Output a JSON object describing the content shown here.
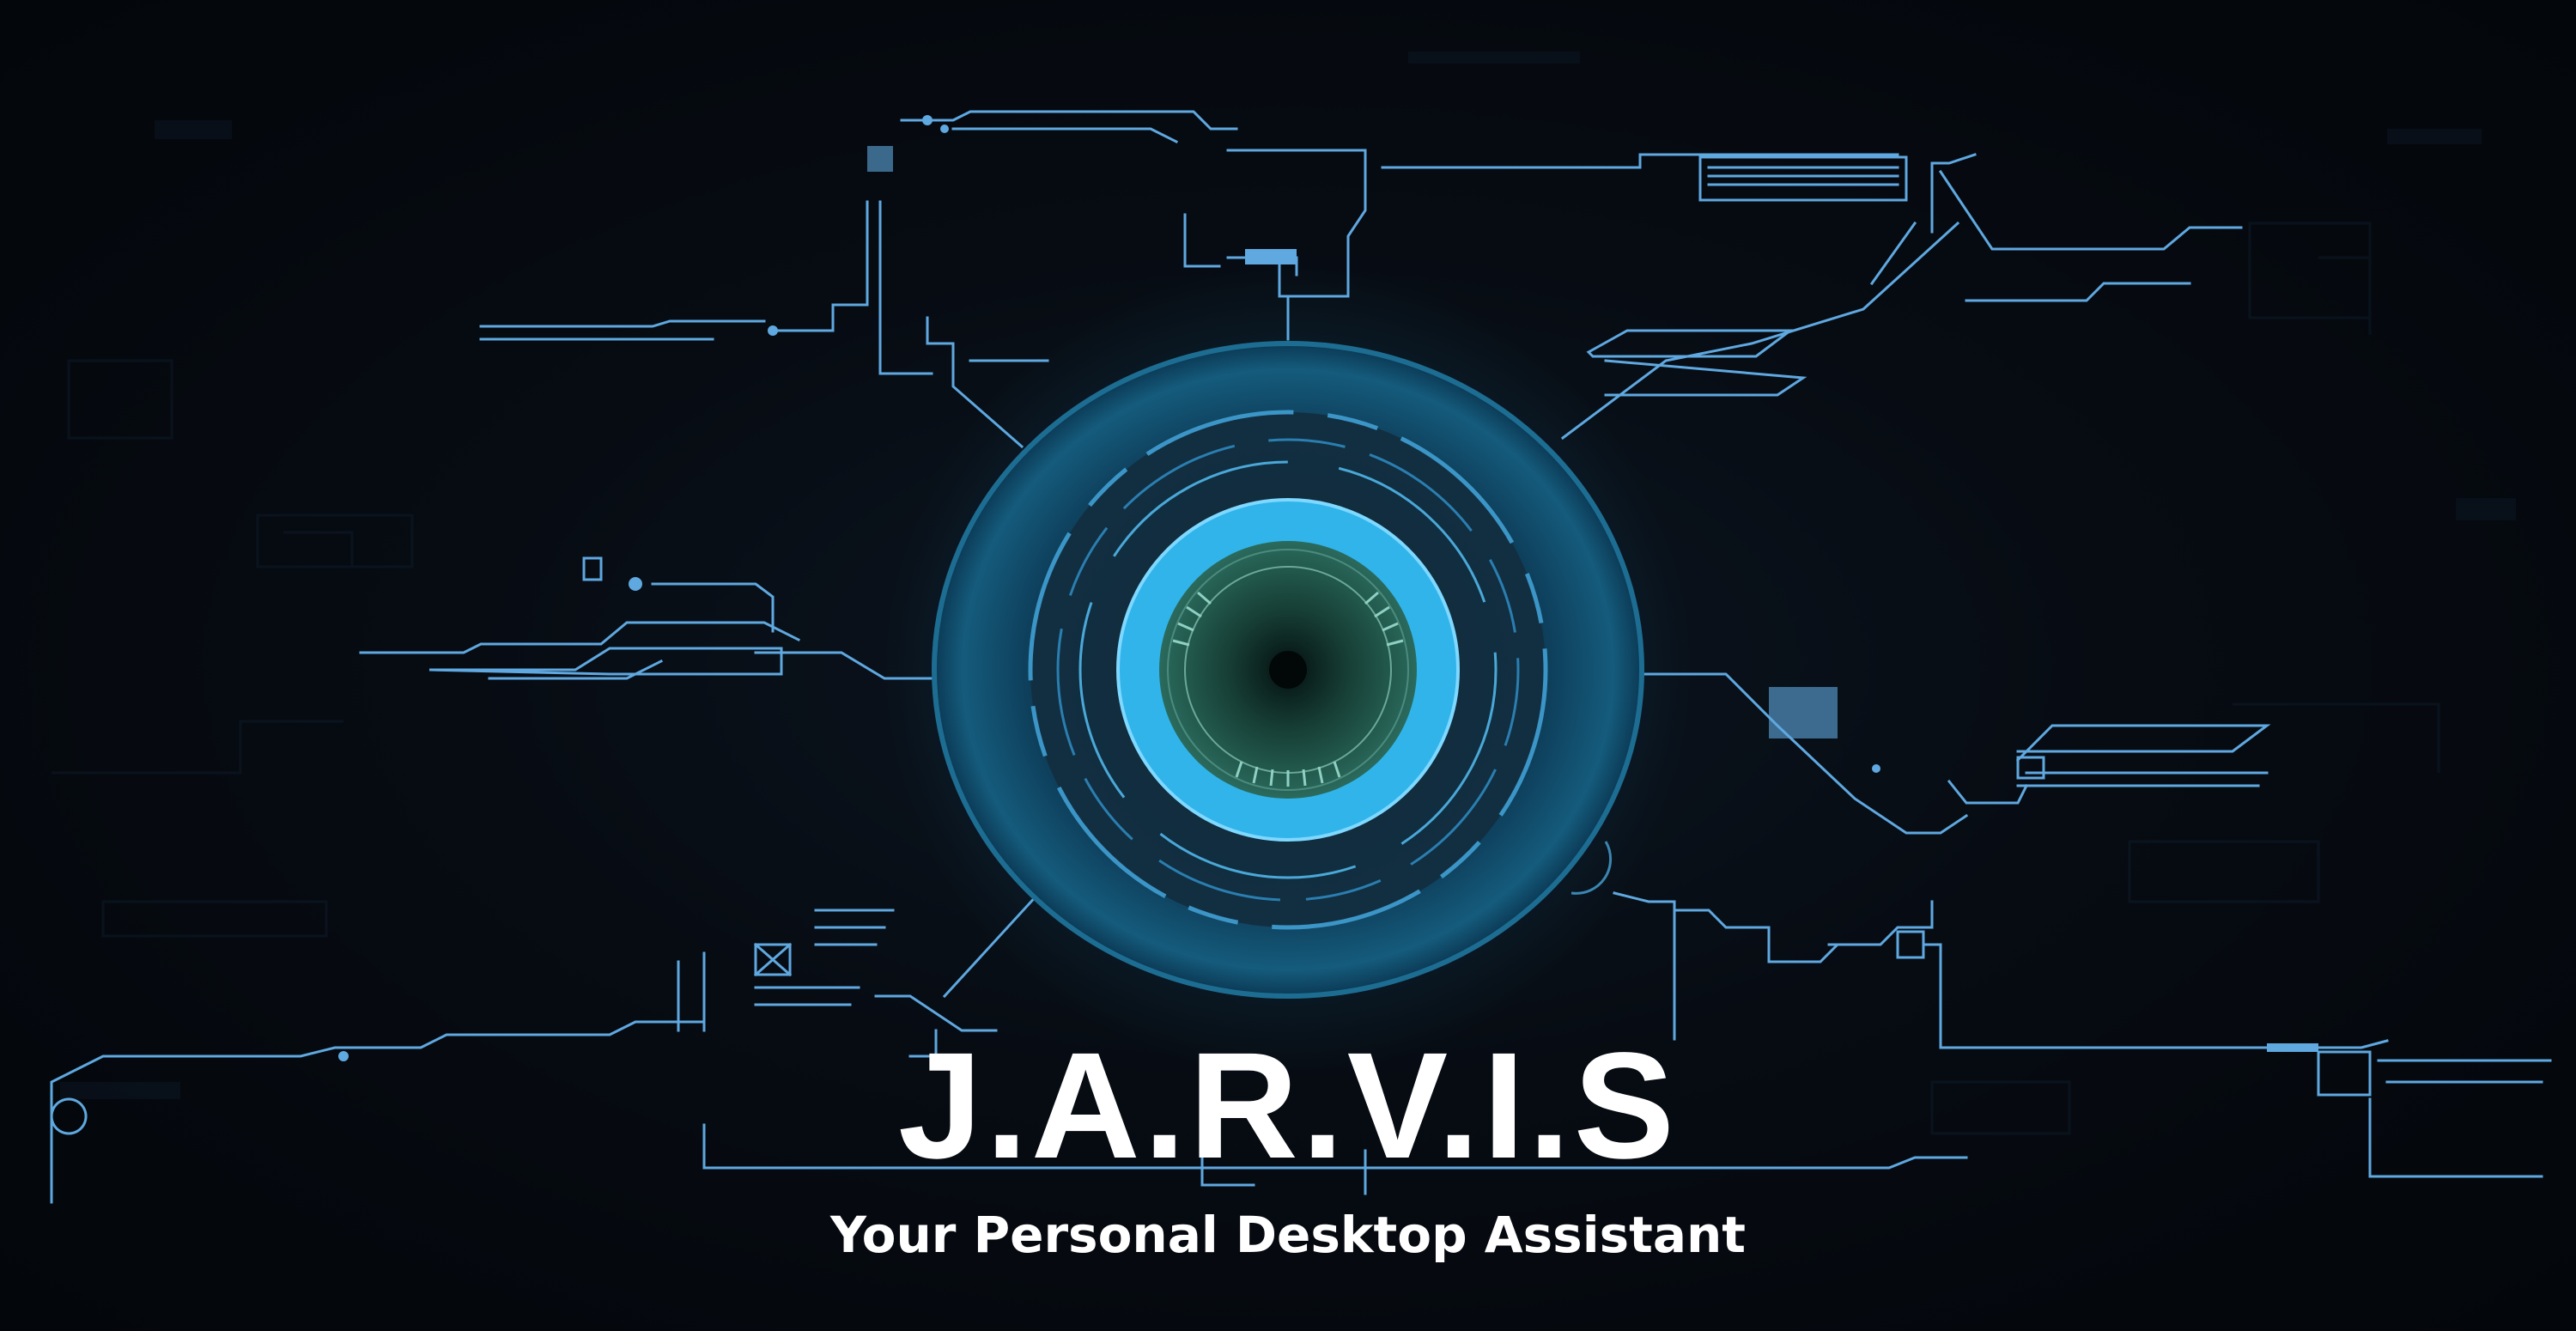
{
  "hero": {
    "title": "J.A.R.V.I.S",
    "subtitle": "Your Personal Desktop Assistant"
  },
  "icons": {
    "core": "circular-hud-eye-icon"
  },
  "colors": {
    "background": "#05080d",
    "circuit_line": "#5fa8e0",
    "ring_dark": "#0f4058",
    "ring_bright": "#36b9ee",
    "iris": "#1d4a3e",
    "text": "#ffffff"
  }
}
